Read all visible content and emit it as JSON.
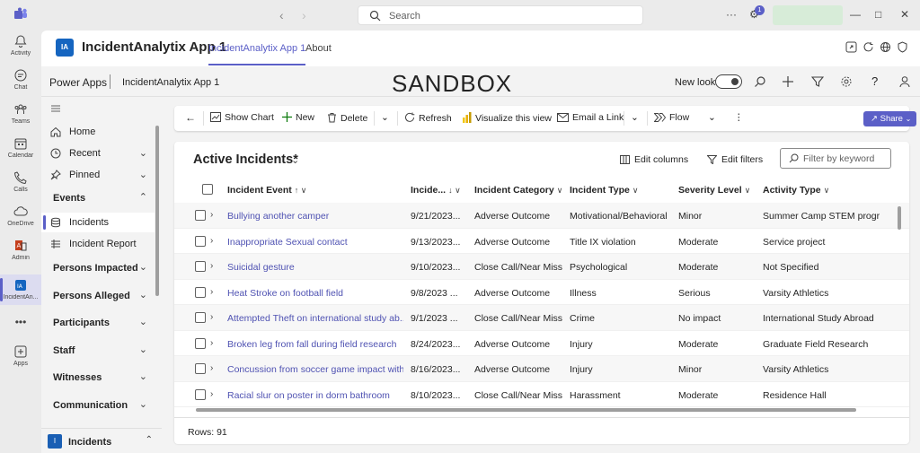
{
  "teams_rail": {
    "items": [
      {
        "label": "Activity",
        "icon": "bell-icon"
      },
      {
        "label": "Chat",
        "icon": "chat-icon"
      },
      {
        "label": "Teams",
        "icon": "teams-icon"
      },
      {
        "label": "Calendar",
        "icon": "calendar-icon"
      },
      {
        "label": "Calls",
        "icon": "phone-icon"
      },
      {
        "label": "OneDrive",
        "icon": "cloud-icon"
      },
      {
        "label": "Admin",
        "icon": "admin-icon"
      },
      {
        "label": "IncidentAn...",
        "icon": "incident-app-icon"
      },
      {
        "label": "Apps",
        "icon": "apps-add-icon"
      }
    ]
  },
  "topbar": {
    "search_placeholder": "Search",
    "notification_count": "1"
  },
  "app_header": {
    "tile_text": "IA",
    "title": "IncidentAnalytix App 1",
    "tabs": [
      {
        "label": "IncidentAnalytix App 1",
        "active": true
      },
      {
        "label": "About",
        "active": false
      }
    ]
  },
  "powerapps_header": {
    "brand": "Power Apps",
    "app_name": "IncidentAnalytix App 1",
    "environment_label": "SANDBOX",
    "new_look_label": "New look"
  },
  "left_nav": {
    "items": [
      {
        "label": "Home",
        "icon": "home-icon"
      },
      {
        "label": "Recent",
        "icon": "clock-icon"
      },
      {
        "label": "Pinned",
        "icon": "pin-icon"
      }
    ],
    "groups": [
      {
        "label": "Events"
      },
      {
        "label": "Persons Impacted"
      },
      {
        "label": "Persons Alleged"
      },
      {
        "label": "Participants"
      },
      {
        "label": "Staff"
      },
      {
        "label": "Witnesses"
      },
      {
        "label": "Communication"
      }
    ],
    "events_items": [
      {
        "label": "Incidents",
        "icon": "database-icon"
      },
      {
        "label": "Incident Report",
        "icon": "report-icon"
      }
    ],
    "area_tile": "I",
    "area_label": "Incidents"
  },
  "command_bar": {
    "show_chart": "Show Chart",
    "new": "New",
    "delete": "Delete",
    "refresh": "Refresh",
    "visualize": "Visualize this view",
    "email_link": "Email a Link",
    "flow": "Flow",
    "share": "Share"
  },
  "grid": {
    "view_title": "Active Incidents*",
    "edit_columns": "Edit columns",
    "edit_filters": "Edit filters",
    "filter_placeholder": "Filter by keyword",
    "columns": [
      {
        "label": "Incident Event",
        "sort": "↑ ∨"
      },
      {
        "label": "Incide...",
        "sort": "↓ ∨"
      },
      {
        "label": "Incident Category",
        "sort": "∨"
      },
      {
        "label": "Incident Type",
        "sort": "∨"
      },
      {
        "label": "Severity Level",
        "sort": "∨"
      },
      {
        "label": "Activity Type",
        "sort": "∨"
      }
    ],
    "rows": [
      {
        "event": "Bullying another camper",
        "date": "9/21/2023...",
        "category": "Adverse Outcome",
        "type": "Motivational/Behavioral",
        "severity": "Minor",
        "activity": "Summer Camp STEM program"
      },
      {
        "event": "Inappropriate Sexual contact",
        "date": "9/13/2023...",
        "category": "Adverse Outcome",
        "type": "Title IX violation",
        "severity": "Moderate",
        "activity": "Service project"
      },
      {
        "event": "Suicidal gesture",
        "date": "9/10/2023...",
        "category": "Close Call/Near Miss",
        "type": "Psychological",
        "severity": "Moderate",
        "activity": "Not Specified"
      },
      {
        "event": "Heat Stroke on football field",
        "date": "9/8/2023 ...",
        "category": "Adverse Outcome",
        "type": "Illness",
        "severity": "Serious",
        "activity": "Varsity Athletics"
      },
      {
        "event": "Attempted Theft on international study ab...",
        "date": "9/1/2023 ...",
        "category": "Close Call/Near Miss",
        "type": "Crime",
        "severity": "No impact",
        "activity": "International Study Abroad"
      },
      {
        "event": "Broken leg from fall during field research",
        "date": "8/24/2023...",
        "category": "Adverse Outcome",
        "type": "Injury",
        "severity": "Moderate",
        "activity": "Graduate Field Research"
      },
      {
        "event": "Concussion from soccer game impact with...",
        "date": "8/16/2023...",
        "category": "Adverse Outcome",
        "type": "Injury",
        "severity": "Minor",
        "activity": "Varsity Athletics"
      },
      {
        "event": "Racial slur on poster in dorm bathroom",
        "date": "8/10/2023...",
        "category": "Close Call/Near Miss",
        "type": "Harassment",
        "severity": "Moderate",
        "activity": "Residence Hall"
      }
    ],
    "rows_label": "Rows: 91"
  },
  "colors": {
    "accent": "#5b5fc7",
    "link": "#4f52b2",
    "app_tile": "#1565c0"
  }
}
